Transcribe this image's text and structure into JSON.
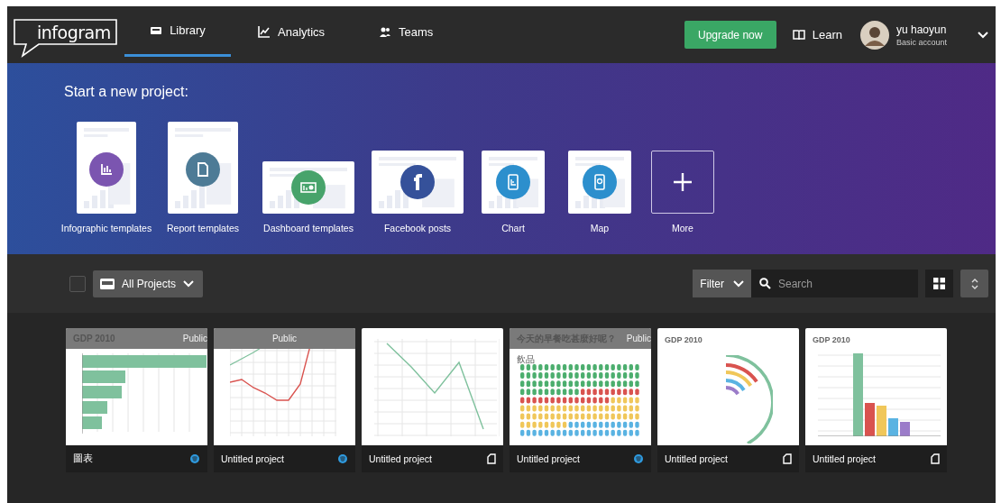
{
  "header": {
    "logo": "infogram",
    "tabs": [
      {
        "label": "Library",
        "selected": true
      },
      {
        "label": "Analytics",
        "selected": false
      },
      {
        "label": "Teams",
        "selected": false
      }
    ],
    "upgrade_button": "Upgrade now",
    "learn_link": "Learn",
    "user": {
      "name": "yu haoyun",
      "account": "Basic account"
    }
  },
  "new_project": {
    "title": "Start a new project:",
    "templates": [
      {
        "label": "Infographic templates",
        "kind": "infographic"
      },
      {
        "label": "Report templates",
        "kind": "report"
      },
      {
        "label": "Dashboard templates",
        "kind": "dashboard"
      },
      {
        "label": "Facebook posts",
        "kind": "facebook"
      },
      {
        "label": "Chart",
        "kind": "chart"
      },
      {
        "label": "Map",
        "kind": "map"
      },
      {
        "label": "More",
        "kind": "more"
      }
    ]
  },
  "toolbar": {
    "select_all": {
      "checked": false
    },
    "folder": "All Projects",
    "filter": "Filter",
    "search": {
      "placeholder": "Search"
    }
  },
  "projects": [
    {
      "name": "圖表",
      "public": true,
      "public_label": "Public",
      "kind": "hbar",
      "thumb_title": "GDP 2010"
    },
    {
      "name": "Untitled project",
      "public": true,
      "public_label": "Public",
      "kind": "dualline"
    },
    {
      "name": "Untitled project",
      "public": false,
      "kind": "line"
    },
    {
      "name": "Untitled project",
      "public": true,
      "public_label": "Public",
      "kind": "pictogram",
      "thumb_title": "今天的早餐吃甚麼好呢？",
      "thumb_subtitle": "飲品"
    },
    {
      "name": "Untitled project",
      "public": false,
      "kind": "arc",
      "thumb_title": "GDP 2010"
    },
    {
      "name": "Untitled project",
      "public": false,
      "kind": "vbar",
      "thumb_title": "GDP 2010"
    }
  ]
}
